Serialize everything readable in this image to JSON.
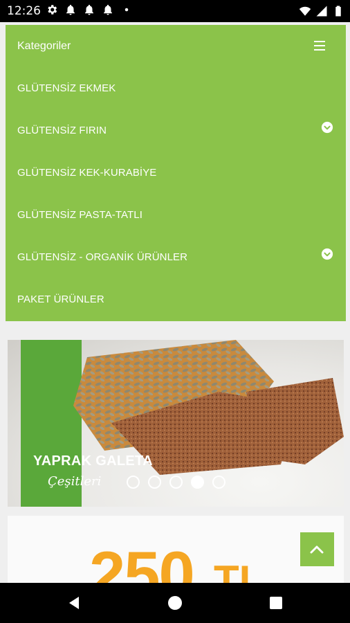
{
  "status_bar": {
    "time": "12:26",
    "left_icons": [
      "settings-icon",
      "notification-bell-icon",
      "notification-bell-icon",
      "notification-bell-icon",
      "dot-icon"
    ],
    "right_icons": [
      "wifi-icon",
      "signal-icon",
      "battery-icon"
    ]
  },
  "menu": {
    "title": "Kategoriler",
    "items": [
      {
        "label": "GLÜTENSİZ EKMEK",
        "has_submenu": false
      },
      {
        "label": "GLÜTENSİZ FIRIN",
        "has_submenu": true
      },
      {
        "label": "GLÜTENSİZ KEK-KURABİYE",
        "has_submenu": false
      },
      {
        "label": "GLÜTENSİZ PASTA-TATLI",
        "has_submenu": false
      },
      {
        "label": "GLÜTENSİZ - ORGANİK ÜRÜNLER",
        "has_submenu": true
      },
      {
        "label": "PAKET ÜRÜNLER",
        "has_submenu": false
      }
    ]
  },
  "slider": {
    "title": "YAPRAK GALETA",
    "subtitle": "Çeşitleri",
    "slide_count": 5,
    "active_index": 3
  },
  "promo": {
    "amount": "250",
    "unit": "TL"
  },
  "colors": {
    "accent_green": "#8bc34a",
    "promo_orange": "#f5a623"
  }
}
